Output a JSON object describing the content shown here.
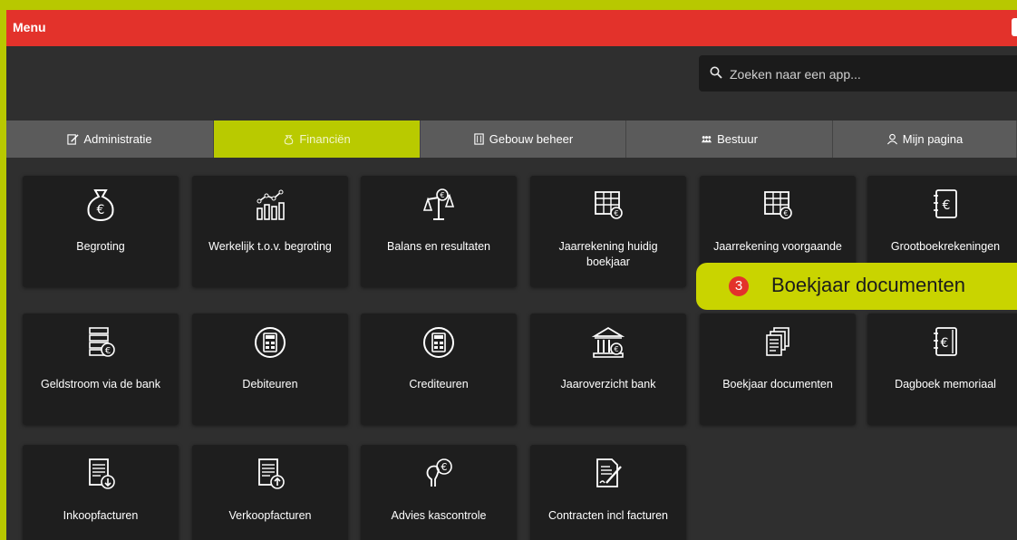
{
  "menubar": {
    "title": "Menu"
  },
  "search": {
    "placeholder": "Zoeken naar een app..."
  },
  "tabs": [
    {
      "label": "Administratie",
      "icon": "edit-icon"
    },
    {
      "label": "Financiën",
      "icon": "money-bag-icon",
      "active": true
    },
    {
      "label": "Gebouw beheer",
      "icon": "building-icon"
    },
    {
      "label": "Bestuur",
      "icon": "people-icon"
    },
    {
      "label": "Mijn pagina",
      "icon": "user-icon"
    }
  ],
  "tiles": [
    {
      "label": "Begroting",
      "icon": "money-bag-euro-icon"
    },
    {
      "label": "Werkelijk t.o.v. begroting",
      "icon": "bar-chart-icon"
    },
    {
      "label": "Balans en resultaten",
      "icon": "scale-euro-icon"
    },
    {
      "label": "Jaarrekening huidig boekjaar",
      "icon": "spreadsheet-euro-icon"
    },
    {
      "label": "Jaarrekening voorgaande",
      "icon": "spreadsheet-euro-icon"
    },
    {
      "label": "Grootboekrekeningen",
      "icon": "ledger-euro-icon"
    },
    {
      "label": "Geldstroom via de bank",
      "icon": "cash-flow-icon"
    },
    {
      "label": "Debiteuren",
      "icon": "calculator-icon"
    },
    {
      "label": "Crediteuren",
      "icon": "calculator-icon"
    },
    {
      "label": "Jaaroverzicht bank",
      "icon": "bank-icon"
    },
    {
      "label": "Boekjaar documenten",
      "icon": "documents-icon"
    },
    {
      "label": "Dagboek memoriaal",
      "icon": "journal-euro-icon"
    },
    {
      "label": "Inkoopfacturen",
      "icon": "invoice-download-icon"
    },
    {
      "label": "Verkoopfacturen",
      "icon": "invoice-upload-icon"
    },
    {
      "label": "Advies kascontrole",
      "icon": "advice-euro-icon"
    },
    {
      "label": "Contracten incl facturen",
      "icon": "contract-sign-icon"
    }
  ],
  "callout": {
    "number": "3",
    "text": "Boekjaar documenten"
  },
  "colors": {
    "menubar": "#e3322b",
    "accent": "#b9ca00",
    "tile": "#1e1e1e",
    "background": "#2f2f2f"
  }
}
